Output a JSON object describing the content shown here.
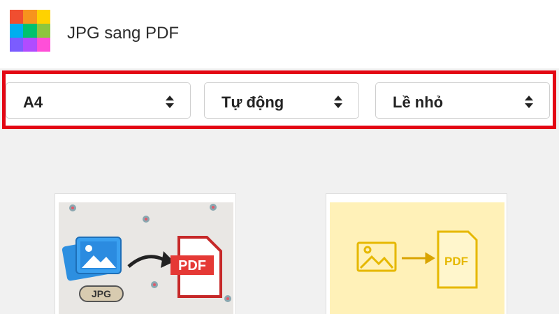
{
  "app": {
    "title": "JPG sang PDF",
    "logo_colors": [
      "#f04e30",
      "#f7941d",
      "#ffd200",
      "#00aeef",
      "#00c26e",
      "#8dc63f",
      "#7b5cff",
      "#b14cff",
      "#ff4fd8"
    ]
  },
  "controls": {
    "page_size": {
      "value": "A4",
      "icon": "up-down-arrows-icon"
    },
    "orientation": {
      "value": "Tự động",
      "icon": "up-down-arrows-icon"
    },
    "margin": {
      "value": "Lề nhỏ",
      "icon": "up-down-arrows-icon"
    },
    "highlight_color": "#e30613"
  },
  "previews": [
    {
      "name": "jpg-to-pdf-illustration",
      "badge": "JPG",
      "target": "PDF"
    },
    {
      "name": "image-to-pdf-sketch",
      "target": "PDF"
    }
  ]
}
